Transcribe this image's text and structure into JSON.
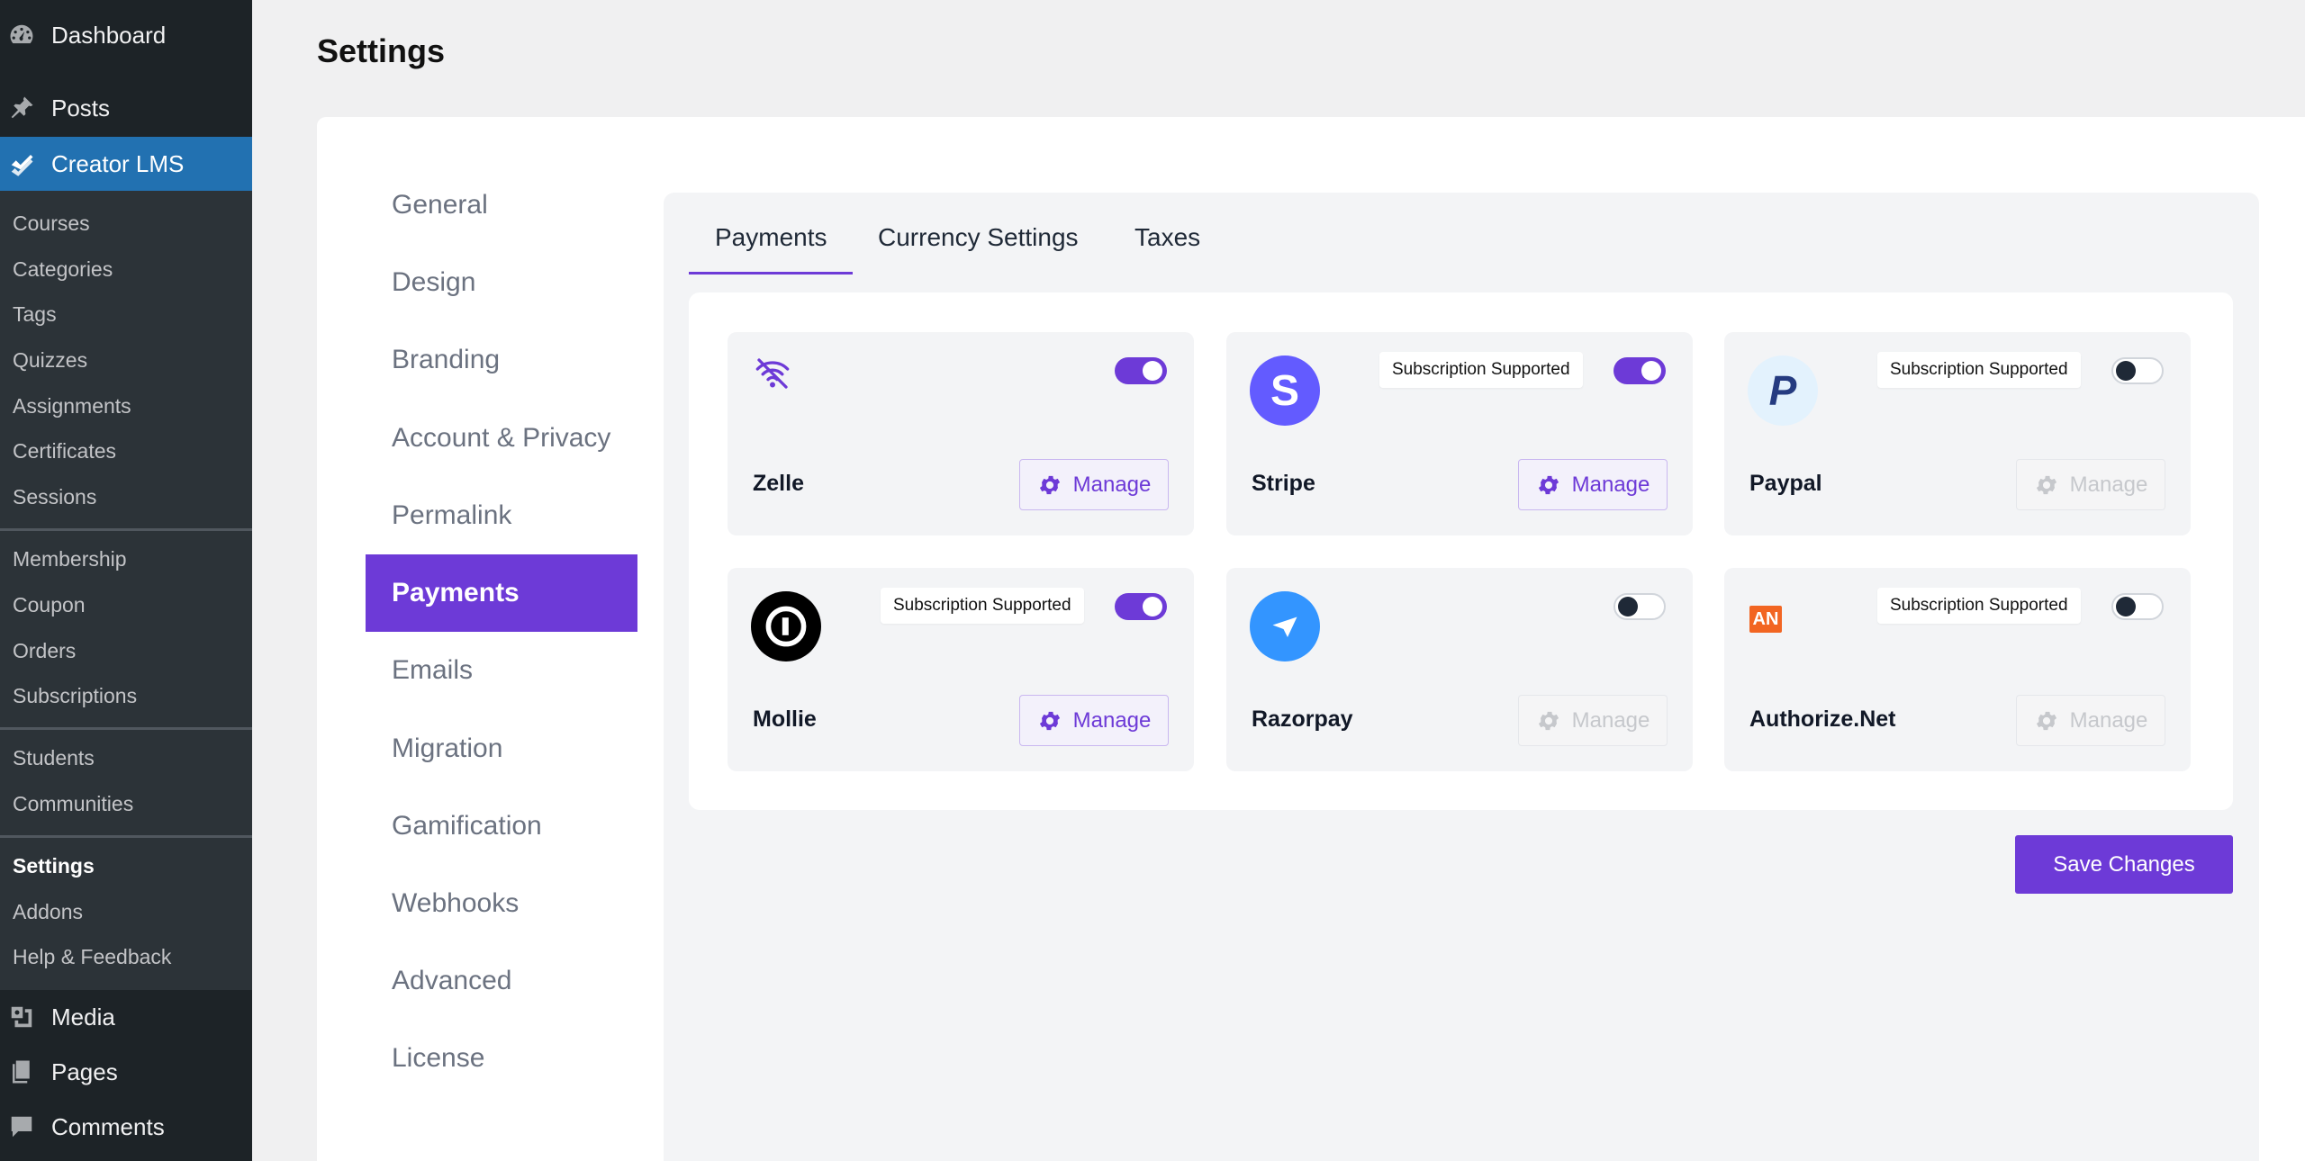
{
  "wp_menu": {
    "dashboard": "Dashboard",
    "posts": "Posts",
    "creator_lms": "Creator LMS",
    "submenu": [
      "Courses",
      "Categories",
      "Tags",
      "Quizzes",
      "Assignments",
      "Certificates",
      "Sessions",
      "Membership",
      "Coupon",
      "Orders",
      "Subscriptions",
      "Students",
      "Communities",
      "Settings",
      "Addons",
      "Help & Feedback"
    ],
    "media": "Media",
    "pages": "Pages",
    "comments": "Comments"
  },
  "page": {
    "title": "Settings"
  },
  "settings_nav": [
    "General",
    "Design",
    "Branding",
    "Account & Privacy",
    "Permalink",
    "Payments",
    "Emails",
    "Migration",
    "Gamification",
    "Webhooks",
    "Advanced",
    "License"
  ],
  "settings_nav_active": "Payments",
  "tabs": [
    "Payments",
    "Currency Settings",
    "Taxes"
  ],
  "active_tab": "Payments",
  "gateways": [
    {
      "name": "Zelle",
      "badge": "",
      "enabled": true,
      "manage_label": "Manage",
      "manage_enabled": true,
      "icon": "zelle-icon"
    },
    {
      "name": "Stripe",
      "badge": "Subscription Supported",
      "enabled": true,
      "manage_label": "Manage",
      "manage_enabled": true,
      "icon": "stripe-icon",
      "logo_text": "S"
    },
    {
      "name": "Paypal",
      "badge": "Subscription Supported",
      "enabled": false,
      "manage_label": "Manage",
      "manage_enabled": false,
      "icon": "paypal-icon",
      "logo_text": "P"
    },
    {
      "name": "Mollie",
      "badge": "Subscription Supported",
      "enabled": true,
      "manage_label": "Manage",
      "manage_enabled": true,
      "icon": "mollie-icon"
    },
    {
      "name": "Razorpay",
      "badge": "",
      "enabled": false,
      "manage_label": "Manage",
      "manage_enabled": false,
      "icon": "razorpay-icon"
    },
    {
      "name": "Authorize.Net",
      "badge": "Subscription Supported",
      "enabled": false,
      "manage_label": "Manage",
      "manage_enabled": false,
      "icon": "authorize-net-icon",
      "logo_text": "AN"
    }
  ],
  "save_button": "Save Changes",
  "colors": {
    "accent": "#6d3ad7",
    "wp_blue": "#2271b1",
    "sidebar": "#1d2327",
    "stripe": "#635bff",
    "paypal_blue": "#253b80",
    "razorpay": "#3395ff",
    "authorize_orange": "#f26522"
  }
}
